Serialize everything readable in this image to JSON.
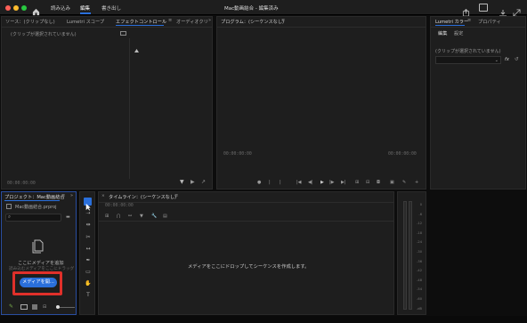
{
  "titlebar": {
    "tabs": [
      "読み込み",
      "編集",
      "書き出し"
    ],
    "title": "Mac動画結合 - 編集済み"
  },
  "source_panel": {
    "tabs": [
      "ソース：(クリップなし)",
      "Lumetri スコープ",
      "エフェクトコントロール",
      "オーディオクリ"
    ],
    "no_clip": "(クリップが選択されていません)",
    "timecode": "00:00:00:00"
  },
  "program_panel": {
    "title": "プログラム：(シーケンスなし)",
    "tc_left": "00:00:00:00",
    "tc_right": "00:00:00:00"
  },
  "lumetri_panel": {
    "tabs": [
      "Lumetri カラー",
      "プロパティ"
    ],
    "subtabs": [
      "編集",
      "設定"
    ],
    "no_clip": "(クリップが選択されていません)",
    "fx_label": "fx"
  },
  "project_panel": {
    "title": "プロジェクト：Mac動画結合",
    "file": "Mac動画結合.prproj",
    "search_placeholder": "",
    "import_text": "ここにメディアを追加",
    "import_sub": "読み込むメディアをここにドラッグ",
    "button_label": "メディアを開..."
  },
  "timeline_panel": {
    "title": "タイムライン：(シーケンスなし)",
    "timecode": "00:00:00:00",
    "drop_text": "メディアをここにドロップしてシーケンスを作成します。"
  },
  "audio_meter": {
    "labels": [
      "0",
      "-6",
      "-12",
      "-18",
      "-24",
      "-30",
      "-36",
      "-42",
      "-48",
      "-54",
      "-60",
      "-dB"
    ]
  },
  "colors": {
    "accent_blue": "#2a6fdb",
    "highlight_red": "#e0302a",
    "panel_bg": "#1e1e1e",
    "app_bg": "#0d0d0d"
  }
}
